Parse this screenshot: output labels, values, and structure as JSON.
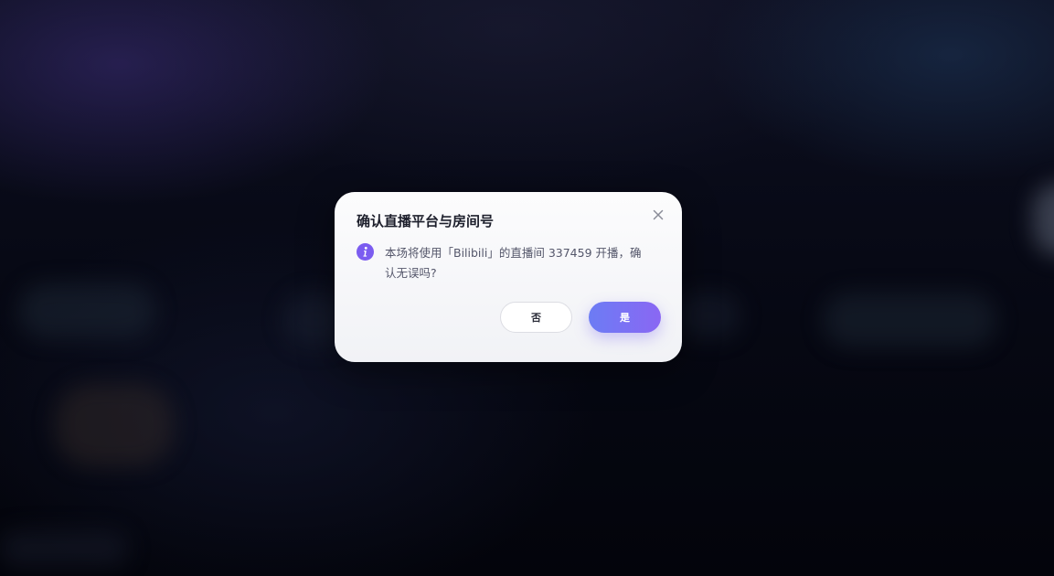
{
  "dialog": {
    "title": "确认直播平台与房间号",
    "message": "本场将使用「Bilibili」的直播间 337459 开播，确认无误吗?",
    "icon": "info-icon",
    "close_icon": "close-icon",
    "buttons": {
      "no_label": "否",
      "yes_label": "是"
    }
  },
  "colors": {
    "accent_start": "#6c7cf4",
    "accent_end": "#8a67f3",
    "info_icon": "#7b5cf0"
  }
}
